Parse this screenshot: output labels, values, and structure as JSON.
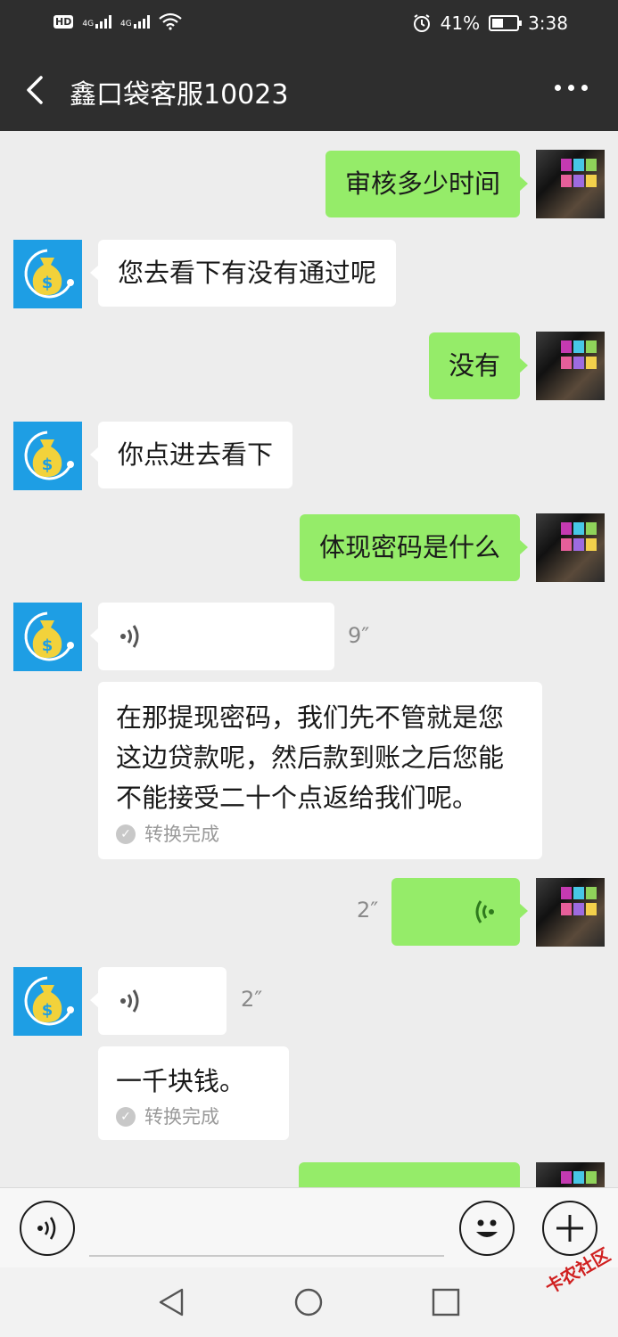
{
  "status": {
    "network_1": "4G",
    "network_2": "4G",
    "battery_pct": "41%",
    "time": "3:38",
    "hd": "HD"
  },
  "header": {
    "title": "鑫口袋客服10023"
  },
  "messages": [
    {
      "side": "user",
      "type": "text",
      "text": "审核多少时间"
    },
    {
      "side": "bot",
      "type": "text",
      "text": "您去看下有没有通过呢"
    },
    {
      "side": "user",
      "type": "text",
      "text": "没有"
    },
    {
      "side": "bot",
      "type": "text",
      "text": "你点进去看下"
    },
    {
      "side": "user",
      "type": "text",
      "text": "体现密码是什么"
    },
    {
      "side": "bot",
      "type": "voice",
      "duration": "9″"
    },
    {
      "side": "bot",
      "type": "transcript",
      "lines": [
        "在那提现密码，我们先不管就是您",
        "这边贷款呢，然后款到账之后您能",
        "不能接受二十个点返给我们呢。"
      ],
      "status": "转换完成"
    },
    {
      "side": "user",
      "type": "voice",
      "duration": "2″"
    },
    {
      "side": "bot",
      "type": "voice",
      "duration": "2″"
    },
    {
      "side": "bot",
      "type": "transcript",
      "lines": [
        "一千块钱。"
      ],
      "status": "转换完成"
    }
  ],
  "watermark": "卡农社区",
  "colors": {
    "header_bg": "#2e2e2e",
    "chat_bg": "#ededed",
    "user_bubble": "#95ec69",
    "bot_bubble": "#ffffff",
    "bot_avatar": "#1e9ee4"
  }
}
